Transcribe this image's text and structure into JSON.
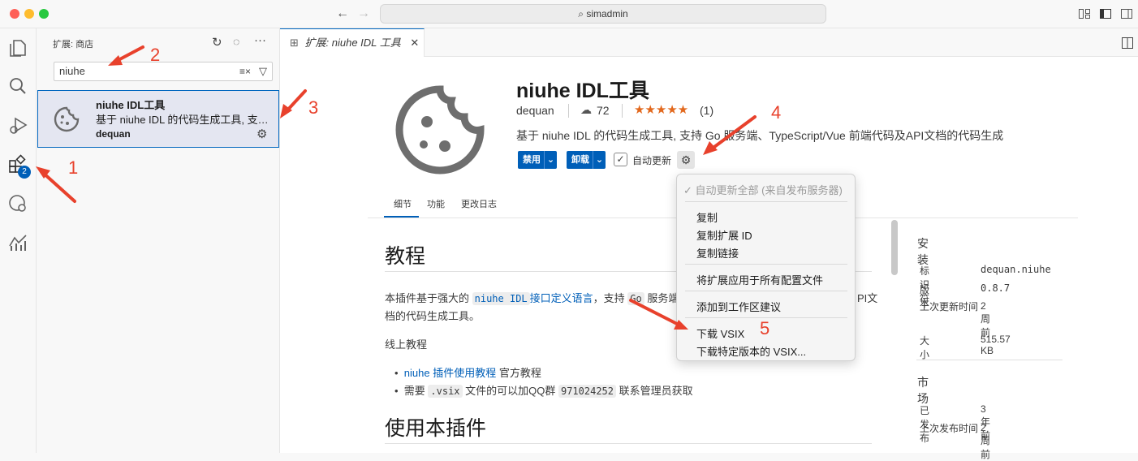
{
  "titlebar": {
    "search": "simadmin"
  },
  "activitybar": {
    "extensions_badge": "2"
  },
  "sidebar": {
    "title": "扩展: 商店",
    "search_value": "niuhe",
    "item": {
      "name": "niuhe IDL工具",
      "description": "基于 niuhe IDL 的代码生成工具, 支…",
      "publisher": "dequan"
    }
  },
  "tab": {
    "label": "扩展: niuhe IDL 工具"
  },
  "extension": {
    "name": "niuhe IDL工具",
    "publisher": "dequan",
    "installs": "72",
    "rating_count": "(1)",
    "description": "基于 niuhe IDL 的代码生成工具, 支持 Go 服务端、TypeScript/Vue 前端代码及API文档的代码生成",
    "disable_label": "禁用",
    "uninstall_label": "卸载",
    "auto_update_label": "自动更新"
  },
  "detail_tabs": [
    "细节",
    "功能",
    "更改日志"
  ],
  "readme": {
    "h1": "教程",
    "p1_a": "本插件基于强大的 ",
    "p1_code": "niuhe IDL",
    "p1_link": "接口定义语言",
    "p1_b": "，支持 ",
    "p1_code2": "Go",
    "p1_c": " 服务端",
    "p1_d": "PI文",
    "p1_e": "档的代码生成工具。",
    "online": "线上教程",
    "li1_link": "niuhe 插件使用教程",
    "li1_text": " 官方教程",
    "li2_a": "需要 ",
    "li2_code": ".vsix",
    "li2_b": " 文件的可以加QQ群 ",
    "li2_code2": "971024252",
    "li2_c": " 联系管理员获取",
    "h2": "使用本插件"
  },
  "install_panel": {
    "title": "安装",
    "rows": [
      {
        "k": "标识符",
        "v": "dequan.niuhe"
      },
      {
        "k": "版本",
        "v": "0.8.7"
      },
      {
        "k": "上次更新时间",
        "v": "2 周前"
      },
      {
        "k": "大小",
        "v": "515.57 KB"
      }
    ],
    "market_title": "市场",
    "market_rows": [
      {
        "k": "已发布",
        "v": "3 年前"
      },
      {
        "k": "上次发布时间",
        "v": "2 周前"
      }
    ]
  },
  "menu": {
    "items": [
      "自动更新全部 (来自发布服务器)",
      "复制",
      "复制扩展 ID",
      "复制链接",
      "将扩展应用于所有配置文件",
      "添加到工作区建议",
      "下载 VSIX",
      "下载特定版本的 VSIX..."
    ]
  },
  "annotations": [
    "1",
    "2",
    "3",
    "4",
    "5"
  ],
  "colors": {
    "accent": "#005fb8",
    "annotation": "#e8412c",
    "star": "#e2681d"
  }
}
